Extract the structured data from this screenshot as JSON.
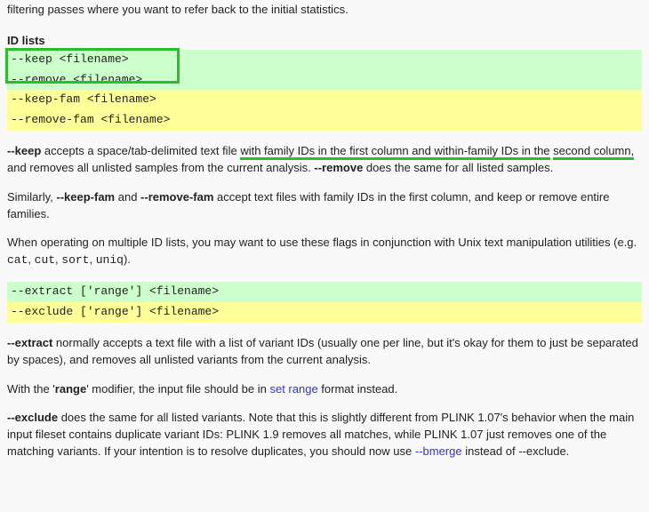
{
  "top_truncated": "filtering passes where you want to refer back to the initial statistics.",
  "heading_id_lists": "ID lists",
  "code1": {
    "l1": "--keep <filename>",
    "l2": "--remove <filename>",
    "l3": "--keep-fam <filename>",
    "l4": "--remove-fam <filename>"
  },
  "p1": {
    "s1a": "--keep",
    "s1b": " accepts a space/tab-delimited text file ",
    "s1c": "with family IDs in the first column and within-family IDs in the",
    "s1d": " ",
    "s1e": "second column,",
    "s1f": " and removes all unlisted samples from the current analysis. ",
    "s1g": "--remove",
    "s1h": " does the same for all listed samples."
  },
  "p2": {
    "a": "Similarly, ",
    "b": "--keep-fam",
    "c": " and ",
    "d": "--remove-fam",
    "e": " accept text files with family IDs in the first column, and keep or remove entire families."
  },
  "p3": {
    "a": "When operating on multiple ID lists, you may want to use these flags in conjunction with Unix text manipulation utilities (e.g. ",
    "cat": "cat",
    "sep1": ", ",
    "cut": "cut",
    "sep2": ", ",
    "sort": "sort",
    "sep3": ", ",
    "uniq": "uniq",
    "end": ")."
  },
  "code2": {
    "l1": "--extract ['range'] <filename>",
    "l2": "--exclude ['range'] <filename>"
  },
  "p4": {
    "a": "--extract",
    "b": " normally accepts a text file with a list of variant IDs (usually one per line, but it's okay for them to just be separated by spaces), and removes all unlisted variants from the current analysis."
  },
  "p5": {
    "a": "With the '",
    "b": "range",
    "c": "' modifier, the input file should be in ",
    "link": "set range",
    "d": " format instead."
  },
  "p6": {
    "a": "--exclude",
    "b": " does the same for all listed variants. Note that this is slightly different from PLINK 1.07's behavior when the main input fileset contains duplicate variant IDs: PLINK 1.9 removes all matches, while PLINK 1.07 just removes one of the matching variants. If your intention is to resolve duplicates, you should now use ",
    "link": "--bmerge",
    "c": " instead of --exclude."
  }
}
